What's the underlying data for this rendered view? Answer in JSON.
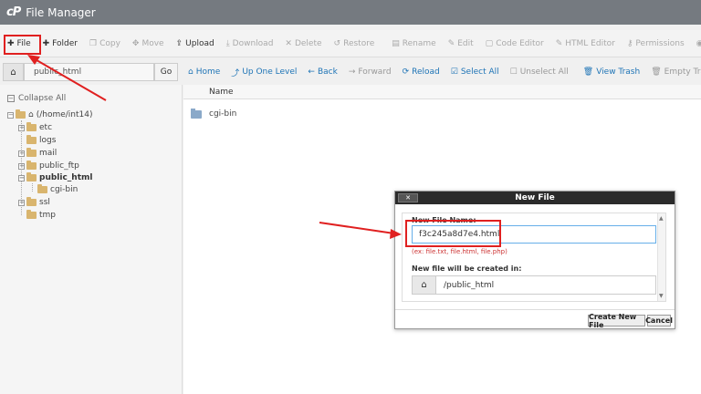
{
  "header": {
    "logo": "cP",
    "title": "File Manager"
  },
  "toolbar": {
    "file": "File",
    "folder": "Folder",
    "copy": "Copy",
    "move": "Move",
    "upload": "Upload",
    "download": "Download",
    "delete": "Delete",
    "restore": "Restore",
    "rename": "Rename",
    "edit": "Edit",
    "code_editor": "Code Editor",
    "html_editor": "HTML Editor",
    "permissions": "Permissions"
  },
  "pathbar": {
    "value": "public_html",
    "go": "Go"
  },
  "nav": {
    "home": "Home",
    "up": "Up One Level",
    "back": "Back",
    "forward": "Forward",
    "reload": "Reload",
    "select_all": "Select All",
    "unselect_all": "Unselect All",
    "view_trash": "View Trash",
    "empty_trash": "Empty Trash"
  },
  "sidebar": {
    "collapse_all": "Collapse All",
    "root": "(/home/int14)",
    "items": [
      "etc",
      "logs",
      "mail",
      "public_ftp",
      "public_html",
      "cgi-bin",
      "ssl",
      "tmp"
    ]
  },
  "filelist": {
    "col_name": "Name",
    "rows": [
      "cgi-bin"
    ]
  },
  "modal": {
    "title": "New File",
    "name_label": "New File Name:",
    "name_value": "f3c245a8d7e4.html",
    "hint": "(ex: file.txt, file.html, file.php)",
    "location_label": "New file will be created in:",
    "location_value": "/public_html",
    "create_btn": "Create New File",
    "cancel_btn": "Cancel"
  },
  "colors": {
    "header_bg": "#757a80",
    "link": "#1e74b6",
    "annotation": "#e02020",
    "modal_title_bg": "#2b2b2b"
  }
}
